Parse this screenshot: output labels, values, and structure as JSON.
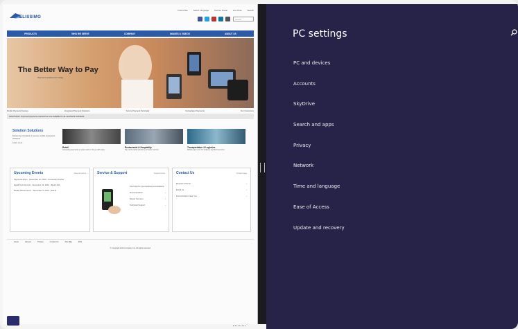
{
  "website": {
    "logo": "ELISSIMO",
    "top_links": [
      "Find a Site",
      "Select Language",
      "Partner Portal",
      "Live Chat",
      "Search"
    ],
    "search_placeholder": "search",
    "nav": [
      "PRODUCTS",
      "WHO WE SERVE",
      "COMPANY",
      "IMAGES & VIDEOS",
      "ABOUT US"
    ],
    "hero_title": "The Better Way to Pay",
    "hero_subtitle": "Payment solutions for today",
    "captions": [
      "Mobile Payment Devices",
      "Integrated Payment Solutions",
      "Secure Payment Terminals",
      "Contactless Payments",
      "Our Customers"
    ],
    "ticker": "Latest News: Improved payment experiences now available for all merchants worldwide",
    "solutions": {
      "title": "Solution Solutions",
      "text": "Delivering innovation in secure mobile & payment solutions",
      "link": "Learn more"
    },
    "tiles": [
      {
        "title": "Retail",
        "text": "Accepting payments in-store and on the go with ease."
      },
      {
        "title": "Restaurants & Hospitality",
        "text": "Pay at the table solutions for faster service."
      },
      {
        "title": "Transportation & Logistics",
        "text": "Mobile payments for delivery and field services."
      }
    ],
    "panels": {
      "events": {
        "title": "Upcoming Events",
        "link": "View all events",
        "items": [
          "Payments Expo · November 12, 2013 · Convention Center",
          "Retail Tech Summit · November 19, 2013 · Booth 210",
          "Mobile World Forum · December 3, 2013 · Hall B"
        ]
      },
      "service": {
        "title": "Service & Support",
        "link": "Support home",
        "text": "Find help for your devices and solutions",
        "links": [
          "Documentation",
          "Repair Services",
          "Technical Support"
        ]
      },
      "contact": {
        "title": "Contact Us",
        "link": "Contact page",
        "links": [
          "Request a Demo",
          "Email Us",
          "Find a Partner Near You"
        ]
      }
    },
    "footer_links": [
      "Home",
      "Careers",
      "Privacy",
      "Contact Us",
      "Site Map",
      "RSS"
    ],
    "copyright": "© Copyright 2013 Company Inc. All rights reserved."
  },
  "settings": {
    "title": "PC settings",
    "items": [
      "PC and devices",
      "Accounts",
      "SkyDrive",
      "Search and apps",
      "Privacy",
      "Network",
      "Time and language",
      "Ease of Access",
      "Update and recovery"
    ]
  },
  "colors": {
    "settings_bg": "#262248",
    "nav_blue": "#2a5aa8",
    "splitter": "#1b1b1f"
  }
}
